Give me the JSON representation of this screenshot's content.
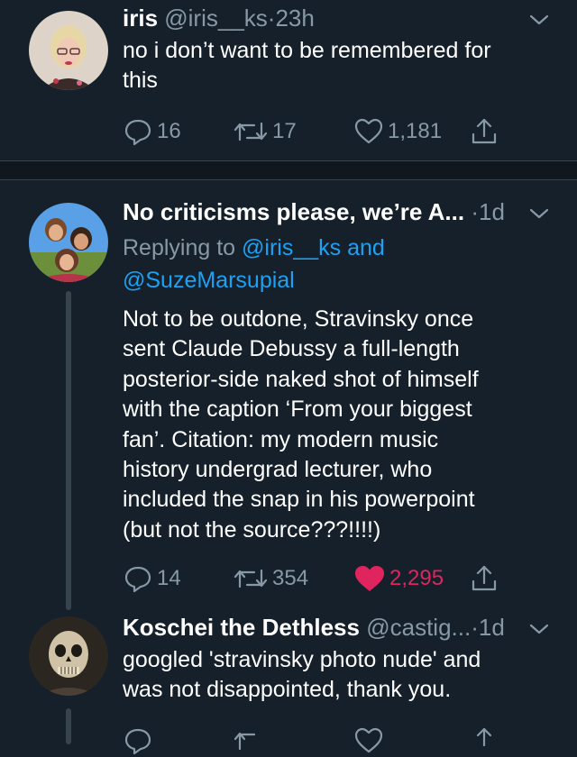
{
  "tweets": [
    {
      "name": "iris",
      "handle": "@iris__ks",
      "dot": "·",
      "time": "23h",
      "text": "no i don’t want to be remembered for\nthis",
      "replies": "16",
      "retweets": "17",
      "likes": "1,181"
    },
    {
      "name": "No criticisms please, we’re A...",
      "dot": "·",
      "time": "1d",
      "replying_prefix": "Replying to",
      "replying_mention1": "@iris__ks",
      "replying_and": "and",
      "replying_mention2": "@SuzeMarsupial",
      "text": "Not to be outdone, Stravinsky once\nsent Claude Debussy a full-length\nposterior-side naked shot of himself\nwith the caption ‘From your biggest\nfan’. Citation: my modern music\nhistory undergrad lecturer, who\nincluded the snap in his powerpoint\n(but not the source???!!!!)",
      "replies": "14",
      "retweets": "354",
      "likes": "2,295"
    },
    {
      "name": "Koschei the Dethless",
      "handle": "@castig...",
      "dot": "·",
      "time": "1d",
      "text": "googled 'stravinsky photo nude' and\nwas not disappointed, thank you."
    }
  ],
  "colors": {
    "background": "#15202b",
    "secondary_text": "#8899a6",
    "link": "#1da1f2",
    "like": "#e0245e"
  }
}
